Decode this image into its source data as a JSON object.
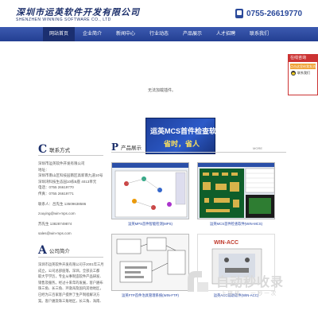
{
  "header": {
    "logo_cn": "深圳市运英软件开发有限公司",
    "logo_en": "SHENZHEN WINNING SOFTWARE CO., LTD",
    "phone": "0755-26619770"
  },
  "nav": {
    "items": [
      "网站首页",
      "企业简介",
      "新闻中心",
      "行业动态",
      "产品展示",
      "人才招聘",
      "联系我们"
    ]
  },
  "message": {
    "text": "无法加载插件。"
  },
  "float_panel": {
    "title": "在线咨询",
    "button": "点击这里给我发消息",
    "row_label": "联系我们"
  },
  "banner": {
    "line1": "运英MCS首件检查软件",
    "line2": "省时，省人"
  },
  "contact": {
    "letter": "C",
    "title": "联系方式",
    "lines": [
      "深圳市运英软件开发有限公司",
      "",
      "地址：",
      "深圳市南山区科技园南区高新南九道10号",
      "",
      "深圳湾科技生态园10栋B座 4013单元",
      "电话：0755 26619770",
      "传真：0755 26619771",
      "",
      "联系人：吕先生 13509638586",
      "",
      "zouying@win-mps.com",
      "",
      "苏先生 13828749874",
      "",
      "sales@win-mps.com"
    ]
  },
  "about": {
    "letter": "A",
    "title": "公司简介",
    "lines": [
      "深圳市运英软件开发有限公司于2001年三月",
      "成立，公司总部座落，深圳，全部员工都",
      "取大学学历，专业从事制造软件产品研发、",
      "销售及服务。经过十来年的发展，客户遍布",
      "珠三角、长三角、环渤海及国内其他地区，",
      "已经为三百家客户提供了生产制程解决方",
      "案。客户遍及珠三角地区，长三角、海南、"
    ]
  },
  "products": {
    "letter": "P",
    "title": "产品展示",
    "more": "MORE",
    "items": [
      {
        "caption": "运英MPS首件智能检测(MPS)"
      },
      {
        "caption": "运英MCS首件检查软件(WIN-MCS)"
      },
      {
        "caption": "运英FTP首件治具管理系统(WIN-FTP)"
      },
      {
        "caption": "运英ACC辅助软件(WIN-ACC)"
      }
    ]
  },
  "watermark": {
    "main": "自动秒收录",
    "sub": "上链接 · 一秒一次"
  },
  "colors": {
    "brand_blue": "#233f92",
    "accent_red": "#cc3333",
    "banner_yellow": "#ffe45c"
  }
}
